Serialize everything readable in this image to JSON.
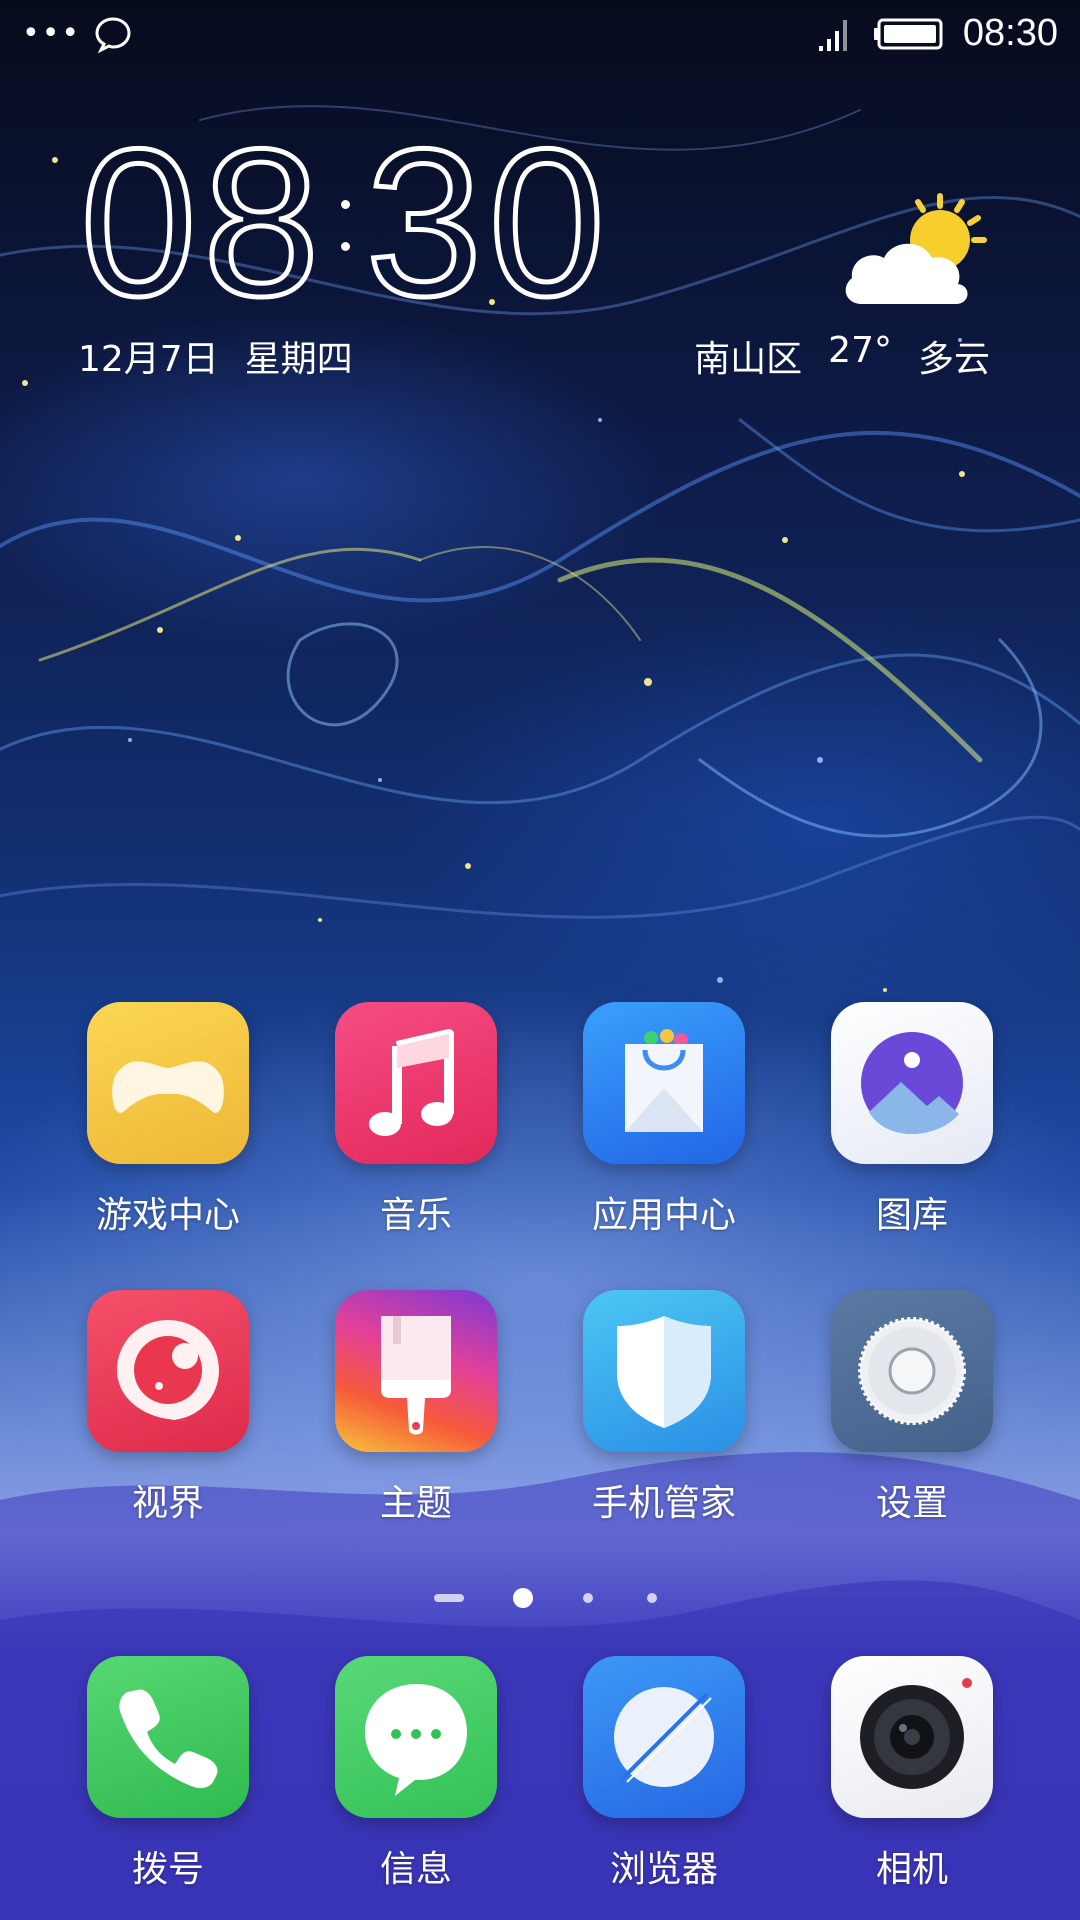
{
  "status_bar": {
    "time": "08:30",
    "icons": [
      "more-dots-icon",
      "chat-bubble-icon",
      "signal-icon",
      "battery-icon"
    ]
  },
  "clock_widget": {
    "hour": "08",
    "minute": "30",
    "date": "12月7日",
    "weekday": "星期四",
    "weather_icon": "sun-cloud-icon",
    "location": "南山区",
    "temperature": "27°",
    "condition": "多云"
  },
  "apps": {
    "row1": [
      {
        "label": "游戏中心",
        "icon": "game-center-icon",
        "color": "#f7c53f"
      },
      {
        "label": "音乐",
        "icon": "music-note-icon",
        "color": "#f03e72"
      },
      {
        "label": "应用中心",
        "icon": "shopping-bag-icon",
        "color": "#2f86f2"
      },
      {
        "label": "图库",
        "icon": "gallery-icon",
        "color": "#eef1fb"
      }
    ],
    "row2": [
      {
        "label": "视界",
        "icon": "video-lens-icon",
        "color": "#ea3a5a"
      },
      {
        "label": "主题",
        "icon": "paint-brush-icon",
        "color": "#c8409a"
      },
      {
        "label": "手机管家",
        "icon": "shield-icon",
        "color": "#3aa9ee"
      },
      {
        "label": "设置",
        "icon": "gear-icon",
        "color": "#4e6e98"
      }
    ]
  },
  "page_indicator": {
    "pages": 4,
    "current": 2
  },
  "dock": [
    {
      "label": "拨号",
      "icon": "phone-icon",
      "color": "#39c85a"
    },
    {
      "label": "信息",
      "icon": "message-icon",
      "color": "#3fcc5e"
    },
    {
      "label": "浏览器",
      "icon": "browser-icon",
      "color": "#2f7ff0"
    },
    {
      "label": "相机",
      "icon": "camera-icon",
      "color": "#f4f5f8"
    }
  ]
}
